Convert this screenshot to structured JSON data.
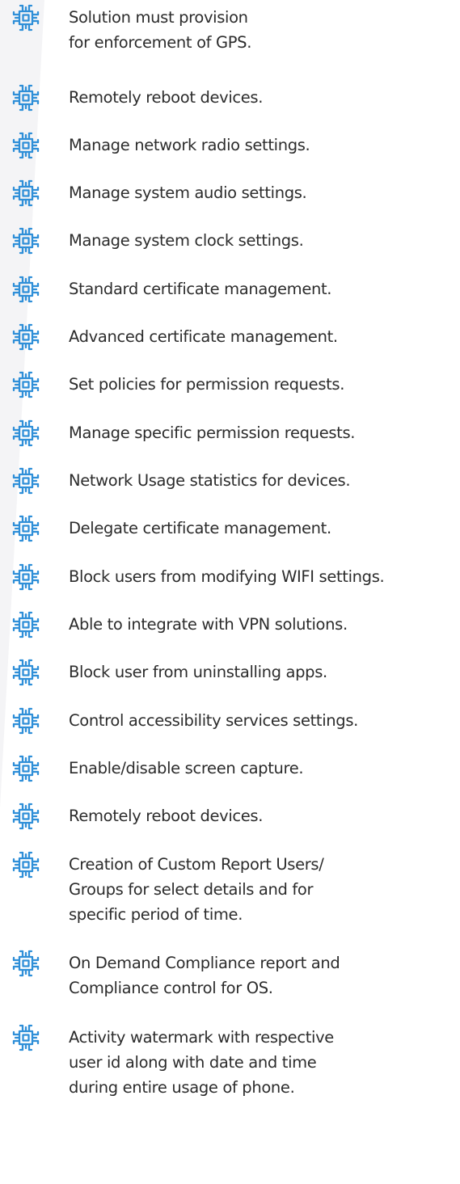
{
  "colors": {
    "icon": "#2f8fd8",
    "text": "#2c2c2c",
    "background": "#ffffff",
    "background_band": "#f4f4f6"
  },
  "icon_name": "microchip-icon",
  "features": [
    {
      "lines": [
        "Solution must provision",
        "for enforcement of GPS."
      ]
    },
    {
      "lines": [
        "Remotely reboot devices."
      ]
    },
    {
      "lines": [
        "Manage network radio settings."
      ]
    },
    {
      "lines": [
        "Manage system audio settings."
      ]
    },
    {
      "lines": [
        "Manage system clock settings."
      ]
    },
    {
      "lines": [
        "Standard certificate management."
      ]
    },
    {
      "lines": [
        "Advanced certificate management."
      ]
    },
    {
      "lines": [
        "Set policies for permission requests."
      ]
    },
    {
      "lines": [
        "Manage specific permission requests."
      ]
    },
    {
      "lines": [
        "Network Usage statistics for devices."
      ]
    },
    {
      "lines": [
        "Delegate certificate management."
      ]
    },
    {
      "lines": [
        "Block users from modifying WIFI settings."
      ]
    },
    {
      "lines": [
        "Able to integrate with VPN solutions."
      ]
    },
    {
      "lines": [
        "Block user from uninstalling apps."
      ]
    },
    {
      "lines": [
        "Control accessibility services settings."
      ]
    },
    {
      "lines": [
        "Enable/disable screen capture."
      ]
    },
    {
      "lines": [
        "Remotely reboot devices."
      ]
    },
    {
      "lines": [
        "Creation of Custom Report Users/",
        "Groups for select details and for",
        "specific period of time."
      ]
    },
    {
      "lines": [
        "On Demand Compliance report and",
        "Compliance control for OS."
      ]
    },
    {
      "lines": [
        "Activity watermark with respective",
        "user id along with date and time",
        "during entire usage of phone."
      ]
    }
  ]
}
